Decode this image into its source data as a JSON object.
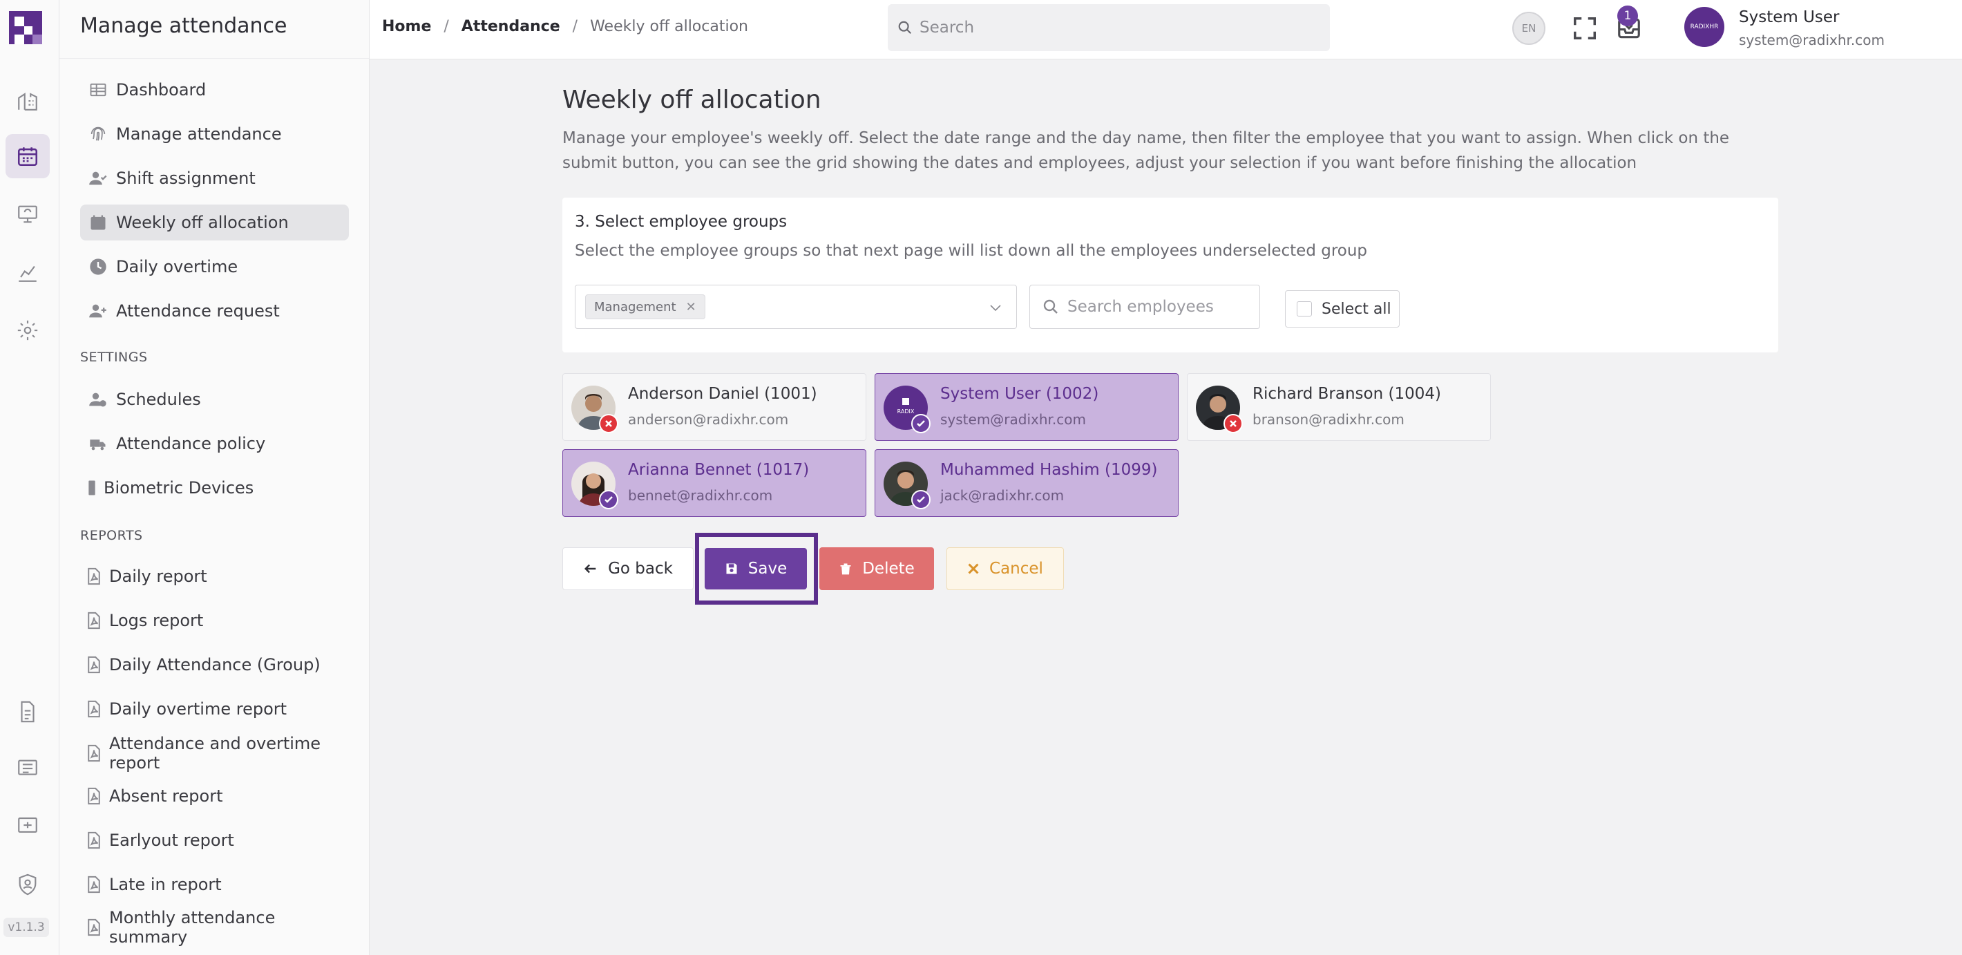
{
  "app": {
    "version": "v1.1.3"
  },
  "rail": {
    "items": [
      {
        "name": "organization-icon"
      },
      {
        "name": "calendar-icon",
        "active": true
      },
      {
        "name": "presentation-icon"
      },
      {
        "name": "analytics-icon"
      },
      {
        "name": "settings-gear-icon"
      },
      {
        "name": "document-icon"
      },
      {
        "name": "list-icon"
      },
      {
        "name": "payroll-icon"
      },
      {
        "name": "shield-user-icon"
      }
    ]
  },
  "sidebar": {
    "title": "Manage attendance",
    "items": [
      {
        "label": "Dashboard",
        "icon": "table-icon"
      },
      {
        "label": "Manage attendance",
        "icon": "fingerprint-icon"
      },
      {
        "label": "Shift assignment",
        "icon": "user-check-icon"
      },
      {
        "label": "Weekly off allocation",
        "icon": "calendar-icon",
        "active": true
      },
      {
        "label": "Daily overtime",
        "icon": "clock-icon"
      },
      {
        "label": "Attendance request",
        "icon": "user-plus-icon"
      }
    ],
    "settings_label": "SETTINGS",
    "settings_items": [
      {
        "label": "Schedules",
        "icon": "user-clock-icon"
      },
      {
        "label": "Attendance policy",
        "icon": "truck-icon"
      },
      {
        "label": "Biometric Devices",
        "icon": "device-icon"
      }
    ],
    "reports_label": "REPORTS",
    "report_items": [
      {
        "label": "Daily report"
      },
      {
        "label": "Logs report"
      },
      {
        "label": "Daily Attendance (Group)"
      },
      {
        "label": "Daily overtime report"
      },
      {
        "label": "Attendance and overtime report"
      },
      {
        "label": "Absent report"
      },
      {
        "label": "Earlyout report"
      },
      {
        "label": "Late in report"
      },
      {
        "label": "Monthly attendance summary"
      }
    ]
  },
  "topbar": {
    "breadcrumb": {
      "home": "Home",
      "section": "Attendance",
      "current": "Weekly off allocation"
    },
    "search_placeholder": "Search",
    "language": "EN",
    "notification_count": "1",
    "user": {
      "name": "System User",
      "email": "system@radixhr.com",
      "avatar_text": "RADIXHR"
    }
  },
  "main": {
    "title": "Weekly off allocation",
    "description": "Manage your employee's weekly off. Select the date range and the day name, then filter the employee that you want to assign. When click on the submit button, you can see the grid showing the dates and employees, adjust your selection if you want before finishing the allocation",
    "step": {
      "title": "3. Select employee groups",
      "subtitle": "Select the employee groups so that next page will list down all the employees underselected group",
      "selected_group": "Management",
      "search_placeholder": "Search employees",
      "select_all_label": "Select all"
    },
    "employees": [
      {
        "name": "Anderson Daniel (1001)",
        "email": "anderson@radixhr.com",
        "selected": false
      },
      {
        "name": "System User (1002)",
        "email": "system@radixhr.com",
        "selected": true
      },
      {
        "name": "Richard Branson (1004)",
        "email": "branson@radixhr.com",
        "selected": false
      },
      {
        "name": "Arianna Bennet (1017)",
        "email": "bennet@radixhr.com",
        "selected": true
      },
      {
        "name": "Muhammed Hashim (1099)",
        "email": "jack@radixhr.com",
        "selected": true
      }
    ],
    "buttons": {
      "back": "Go back",
      "save": "Save",
      "delete": "Delete",
      "cancel": "Cancel"
    }
  },
  "colors": {
    "brand": "#6b3fa0",
    "selected_bg": "#c9b3de",
    "delete": "#e07070",
    "cancel_text": "#d9932b",
    "status_unselected": "#e0353b"
  }
}
